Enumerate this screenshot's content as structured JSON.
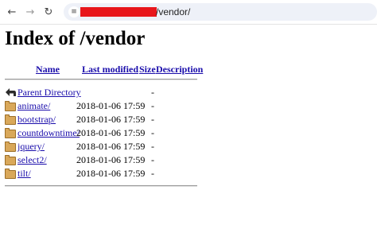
{
  "browser": {
    "url_path": "/vendor/"
  },
  "page": {
    "title": "Index of /vendor",
    "columns": {
      "name": "Name",
      "last_modified": "Last modified",
      "size": "Size",
      "description": "Description"
    },
    "parent": {
      "name": "Parent Directory",
      "size": "-"
    },
    "entries": [
      {
        "name": "animate/",
        "modified": "2018-01-06 17:59",
        "size": "-"
      },
      {
        "name": "bootstrap/",
        "modified": "2018-01-06 17:59",
        "size": "-"
      },
      {
        "name": "countdowntime/",
        "modified": "2018-01-06 17:59",
        "size": "-"
      },
      {
        "name": "jquery/",
        "modified": "2018-01-06 17:59",
        "size": "-"
      },
      {
        "name": "select2/",
        "modified": "2018-01-06 17:59",
        "size": "-"
      },
      {
        "name": "tilt/",
        "modified": "2018-01-06 17:59",
        "size": "-"
      }
    ]
  }
}
